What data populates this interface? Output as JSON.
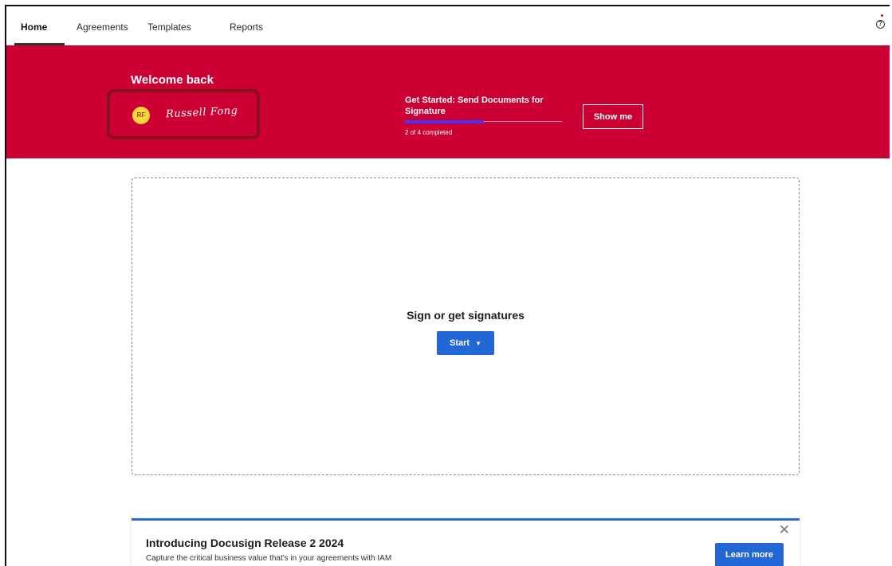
{
  "nav": {
    "tabs": [
      {
        "label": "Home",
        "active": true
      },
      {
        "label": "Agreements",
        "active": false
      },
      {
        "label": "Templates",
        "active": false
      },
      {
        "label": "Reports",
        "active": false
      }
    ],
    "help_icon": "question-circle"
  },
  "banner": {
    "welcome": "Welcome back",
    "avatar_initials": "RF",
    "signature": "Russell Fong",
    "get_started_title": "Get Started: Send Documents for Signature",
    "progress_completed": 2,
    "progress_total": 4,
    "progress_text": "2 of 4 completed",
    "show_me_label": "Show me",
    "color": "#cc0033",
    "progress_color": "#4433ff"
  },
  "dropzone": {
    "title": "Sign or get signatures",
    "start_label": "Start"
  },
  "release_card": {
    "title": "Introducing Docusign Release 2 2024",
    "subtitle": "Capture the critical business value that's in your agreements with IAM",
    "learn_more_label": "Learn more",
    "close_icon": "close-x"
  },
  "accent_color": "#2366d6"
}
